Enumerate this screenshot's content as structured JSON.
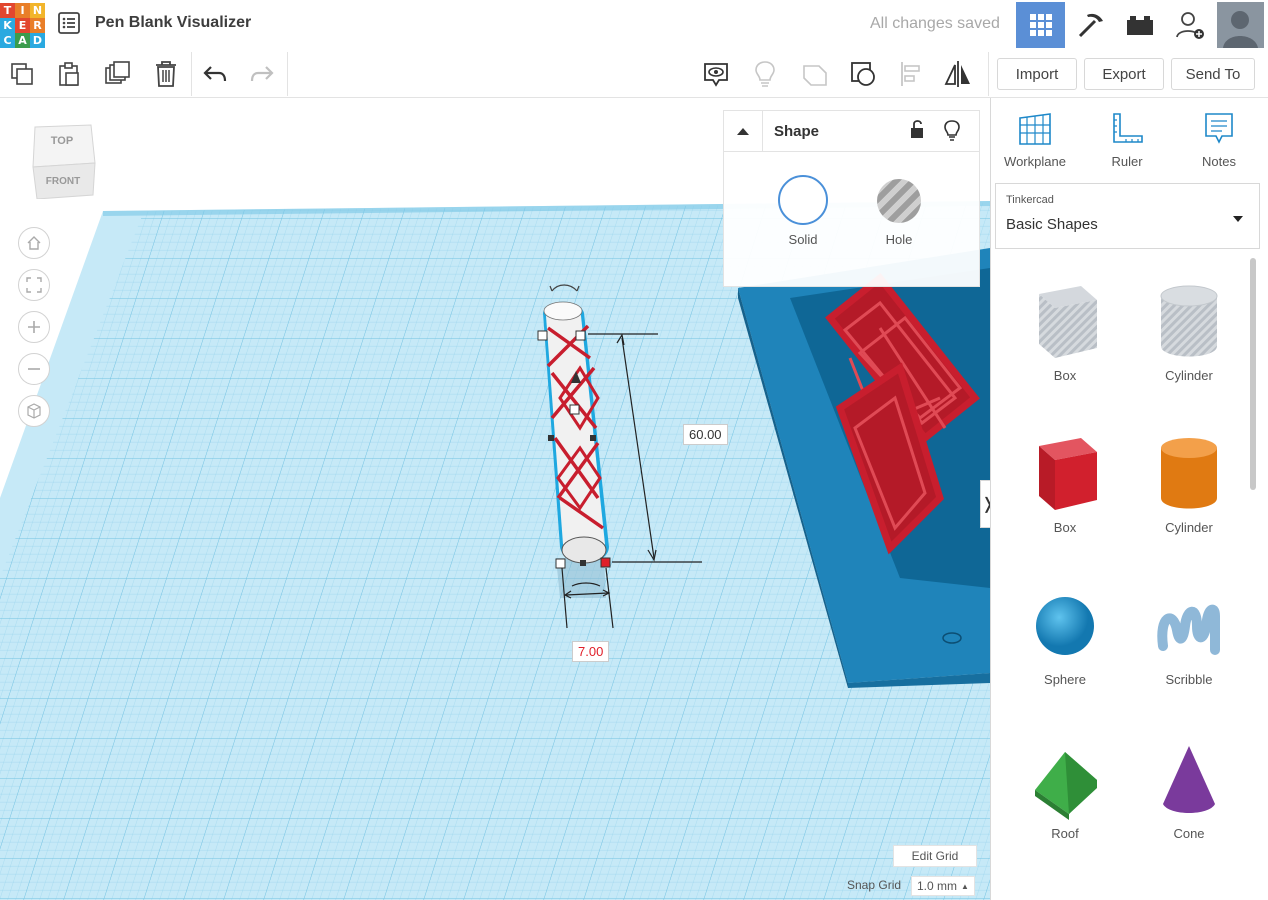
{
  "header": {
    "logo_letters": [
      "T",
      "I",
      "N",
      "K",
      "E",
      "R",
      "C",
      "A",
      "D"
    ],
    "logo_colors": [
      "#e2472f",
      "#e97e28",
      "#f2b52b",
      "#2aa9e0",
      "#e2472f",
      "#e97e28",
      "#2aa9e0",
      "#3a9c4d",
      "#2aa9e0"
    ],
    "title": "Pen Blank Visualizer",
    "save_status": "All changes saved"
  },
  "toolbar": {
    "import_label": "Import",
    "export_label": "Export",
    "send_to_label": "Send To"
  },
  "view_cube": {
    "top_label": "TOP",
    "front_label": "FRONT"
  },
  "inspector": {
    "title": "Shape",
    "solid_label": "Solid",
    "hole_label": "Hole"
  },
  "dimensions": {
    "height_value": "60.00",
    "width_value": "7.00"
  },
  "panel": {
    "workplane_label": "Workplane",
    "ruler_label": "Ruler",
    "notes_label": "Notes",
    "library_source": "Tinkercad",
    "library_name": "Basic Shapes",
    "shapes": [
      {
        "label": "Box"
      },
      {
        "label": "Cylinder"
      },
      {
        "label": "Box"
      },
      {
        "label": "Cylinder"
      },
      {
        "label": "Sphere"
      },
      {
        "label": "Scribble"
      },
      {
        "label": "Roof"
      },
      {
        "label": "Cone"
      }
    ]
  },
  "footer": {
    "edit_grid_label": "Edit Grid",
    "snap_grid_label": "Snap Grid",
    "snap_grid_value": "1.0 mm"
  },
  "colors": {
    "accent": "#5b8fd6",
    "grid_bg": "#bfe6f5",
    "grid_line": "#8fd0ea",
    "selection": "#1fa8e0",
    "pattern_red": "#c81e2e",
    "tray_blue": "#1b7fb3"
  }
}
